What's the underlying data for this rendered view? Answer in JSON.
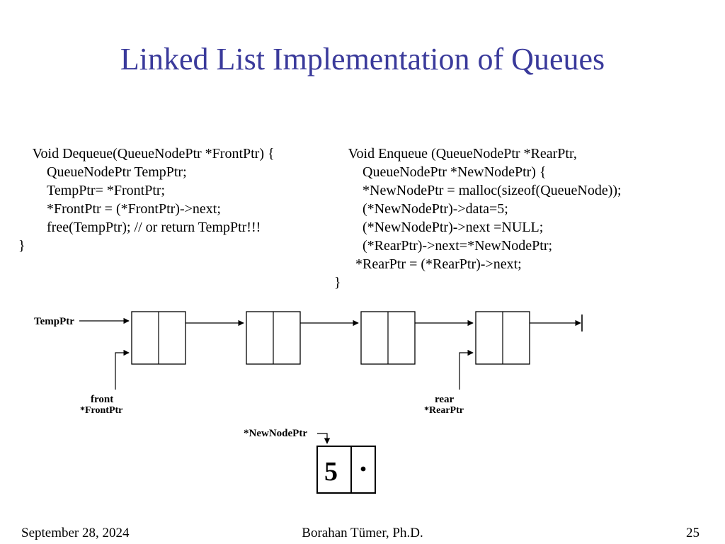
{
  "title": "Linked List Implementation of Queues",
  "code_left": {
    "l1": "Void Dequeue(QueueNodePtr *FrontPtr) {",
    "l2": "QueueNodePtr TempPtr;",
    "l3": "TempPtr= *FrontPtr;",
    "l4": "*FrontPtr = (*FrontPtr)->next;",
    "l5": "free(TempPtr); // or return TempPtr!!!",
    "l6": "}"
  },
  "code_right": {
    "l1": "Void Enqueue (QueueNodePtr *RearPtr,",
    "l2": "QueueNodePtr *NewNodePtr) {",
    "l3": "*NewNodePtr = malloc(sizeof(QueueNode));",
    "l4": "(*NewNodePtr)->data=5;",
    "l5": "(*NewNodePtr)->next =NULL;",
    "l6": "(*RearPtr)->next=*NewNodePtr;",
    "l7": "*RearPtr = (*RearPtr)->next;",
    "l8": "}"
  },
  "diagram": {
    "temp_ptr": "TempPtr",
    "front_top": "front",
    "front_bot": "*FrontPtr",
    "rear_top": "rear",
    "rear_bot": "*RearPtr",
    "newnode_lbl": "*NewNodePtr",
    "newnode_val": "5"
  },
  "footer": {
    "date": "September 28, 2024",
    "author": "Borahan Tümer, Ph.D.",
    "page": "25"
  }
}
